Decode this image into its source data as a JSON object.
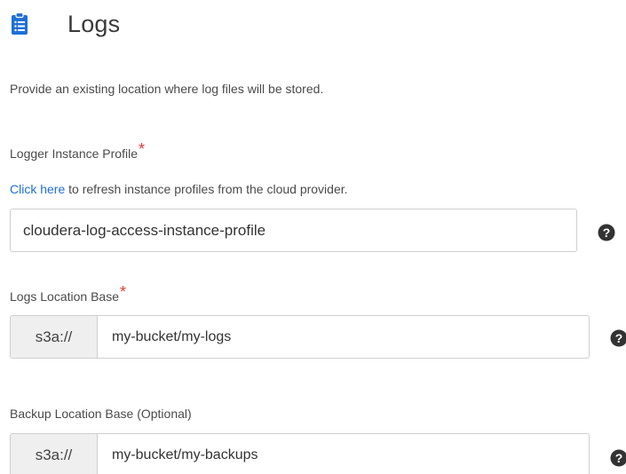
{
  "header": {
    "title": "Logs",
    "icon": "clipboard-list-icon",
    "icon_color": "#1f6fd6"
  },
  "intro": "Provide an existing location where log files will be stored.",
  "logger_profile": {
    "label": "Logger Instance Profile",
    "required_mark": "*",
    "helper_link": "Click here",
    "helper_text": " to refresh instance profiles from the cloud provider.",
    "value": "cloudera-log-access-instance-profile"
  },
  "logs_location": {
    "label": "Logs Location Base",
    "required_mark": "*",
    "prefix": "s3a://",
    "value": "my-bucket/my-logs"
  },
  "backup_location": {
    "label": "Backup Location Base (Optional)",
    "prefix": "s3a://",
    "value": "my-bucket/my-backups"
  },
  "colors": {
    "link": "#1f6fd6",
    "required": "#e53935",
    "help_icon": "#333333"
  }
}
